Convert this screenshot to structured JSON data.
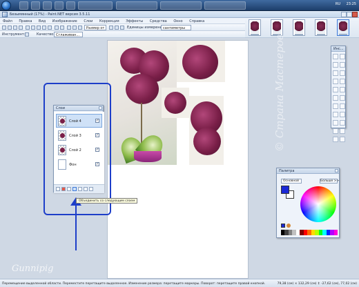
{
  "window": {
    "title": "Безымянный (17%) - Paint.NET версия 3.5.11",
    "taskbar": {
      "lang": "RU",
      "time": "23:25"
    }
  },
  "menu": [
    "Файл",
    "Правка",
    "Вид",
    "Изображение",
    "Слои",
    "Коррекция",
    "Эффекты",
    "Средства",
    "Окно",
    "Справка"
  ],
  "toolbar": {
    "size_label": "Размер от",
    "units_label": "Единицы измерения",
    "units_value": "сантиметры",
    "tool_label": "Инструмент:",
    "quality_label": "Качество:",
    "quality_value": "Сглаживан..."
  },
  "layers_panel": {
    "title": "Слои",
    "layers": [
      {
        "name": "Слой 4",
        "visible": true,
        "selected": true
      },
      {
        "name": "Слой 3",
        "visible": true,
        "selected": false
      },
      {
        "name": "Слой 2",
        "visible": true,
        "selected": false
      },
      {
        "name": "Фон",
        "visible": true,
        "selected": false
      }
    ],
    "tooltip": "Объединить со следующим слоем"
  },
  "tools_panel": {
    "title": "Инс..."
  },
  "palette_panel": {
    "title": "Палитра",
    "mode": "Основной",
    "more_button": "Больше >>"
  },
  "status": {
    "text": "Перемещение выделенной области. Переместите перетащите выделенное. Изменение размера: перетащите маркеры. Поворот: перетащите правой кнопкой.",
    "right": "79,38 (см) × 132,29 (см)    ↕ -27,62 (см), 77,02 (см)"
  },
  "watermarks": {
    "left": "Gunnipig",
    "right": "© Страна Мастеров"
  },
  "colors": {
    "annotation": "#1d3ec9",
    "primary": "#1a28d6",
    "flower": "#7a1f48"
  }
}
